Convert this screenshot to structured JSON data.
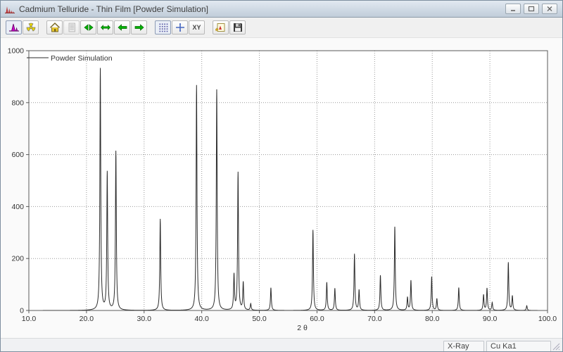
{
  "window": {
    "title": "Cadmium Telluride - Thin Film [Powder Simulation]"
  },
  "toolbar": {
    "buttons": [
      {
        "name": "simulation-pattern-button",
        "icon": "histogram-icon",
        "pressed": true,
        "group": 1
      },
      {
        "name": "radiation-button",
        "icon": "radiation-icon",
        "pressed": false,
        "group": 1
      },
      {
        "name": "home-view-button",
        "icon": "home-icon",
        "pressed": false,
        "group": 2
      },
      {
        "name": "data-list-button",
        "icon": "list-icon",
        "pressed": false,
        "disabled": true,
        "group": 2
      },
      {
        "name": "zoom-in-horizontal-button",
        "icon": "arrows-inward-icon",
        "pressed": false,
        "group": 2
      },
      {
        "name": "zoom-out-horizontal-button",
        "icon": "arrows-outward-icon",
        "pressed": false,
        "group": 2
      },
      {
        "name": "pan-left-button",
        "icon": "arrow-left-icon",
        "pressed": false,
        "group": 2
      },
      {
        "name": "pan-right-button",
        "icon": "arrow-right-icon",
        "pressed": false,
        "group": 2
      },
      {
        "name": "grid-toggle-button",
        "icon": "grid-icon",
        "pressed": true,
        "group": 3
      },
      {
        "name": "crosshair-button",
        "icon": "crosshair-icon",
        "pressed": false,
        "group": 3
      },
      {
        "name": "xy-readout-button",
        "icon": "xy-text-icon",
        "label": "XY",
        "pressed": false,
        "group": 3
      },
      {
        "name": "copy-pattern-button",
        "icon": "export-image-icon",
        "pressed": false,
        "group": 4
      },
      {
        "name": "save-button",
        "icon": "save-icon",
        "pressed": false,
        "group": 4
      }
    ]
  },
  "chart_data": {
    "type": "line",
    "title": "Powder Simulation",
    "legend": [
      "Powder Simulation"
    ],
    "legend_position": "top-left",
    "xlabel": "2 θ",
    "ylabel": "",
    "xlim": [
      10.0,
      100.0
    ],
    "ylim": [
      0,
      1000
    ],
    "x_tick_values": [
      10,
      20,
      30,
      40,
      50,
      60,
      70,
      80,
      90,
      100
    ],
    "x_tick_labels": [
      "10.0",
      "20.0",
      "30.0",
      "40.0",
      "50.0",
      "60.0",
      "70.0",
      "80.0",
      "90.0",
      "100.0"
    ],
    "y_tick_values": [
      0,
      200,
      400,
      600,
      800,
      1000
    ],
    "y_tick_labels": [
      "0",
      "200",
      "400",
      "600",
      "800",
      "1000"
    ],
    "grid": true,
    "series": [
      {
        "name": "Powder Simulation",
        "peak_shape": "lorentzian",
        "peak_hwhm": 0.09,
        "peaks": [
          {
            "two_theta": 22.4,
            "intensity": 930
          },
          {
            "two_theta": 23.6,
            "intensity": 530
          },
          {
            "two_theta": 25.1,
            "intensity": 612
          },
          {
            "two_theta": 32.8,
            "intensity": 352
          },
          {
            "two_theta": 39.1,
            "intensity": 867
          },
          {
            "two_theta": 42.6,
            "intensity": 850
          },
          {
            "two_theta": 45.6,
            "intensity": 135
          },
          {
            "two_theta": 46.3,
            "intensity": 530
          },
          {
            "two_theta": 47.2,
            "intensity": 106
          },
          {
            "two_theta": 48.5,
            "intensity": 25
          },
          {
            "two_theta": 52.0,
            "intensity": 87
          },
          {
            "two_theta": 59.3,
            "intensity": 310
          },
          {
            "two_theta": 61.7,
            "intensity": 108
          },
          {
            "two_theta": 63.1,
            "intensity": 85
          },
          {
            "two_theta": 66.5,
            "intensity": 217
          },
          {
            "two_theta": 67.3,
            "intensity": 78
          },
          {
            "two_theta": 71.0,
            "intensity": 135
          },
          {
            "two_theta": 73.5,
            "intensity": 322
          },
          {
            "two_theta": 75.7,
            "intensity": 50
          },
          {
            "two_theta": 76.3,
            "intensity": 115
          },
          {
            "two_theta": 79.9,
            "intensity": 130
          },
          {
            "two_theta": 80.8,
            "intensity": 45
          },
          {
            "two_theta": 84.6,
            "intensity": 88
          },
          {
            "two_theta": 88.9,
            "intensity": 60
          },
          {
            "two_theta": 89.5,
            "intensity": 85
          },
          {
            "two_theta": 90.4,
            "intensity": 30
          },
          {
            "two_theta": 93.2,
            "intensity": 185
          },
          {
            "two_theta": 93.9,
            "intensity": 55
          },
          {
            "two_theta": 96.4,
            "intensity": 18
          }
        ]
      }
    ]
  },
  "status_bar": {
    "radiation_type": "X-Ray",
    "wavelength": "Cu Ka1"
  },
  "colors": {
    "titlebar_top": "#e2e9f1",
    "titlebar_bottom": "#c1cdda",
    "toolbar_bg": "#f0f0f0",
    "plot_bg": "#ffffff",
    "trace": "#2b2b2b",
    "grid": "#999999",
    "accent_green": "#00b400",
    "accent_magenta": "#cc00cc",
    "accent_yellow": "#e8d400"
  }
}
